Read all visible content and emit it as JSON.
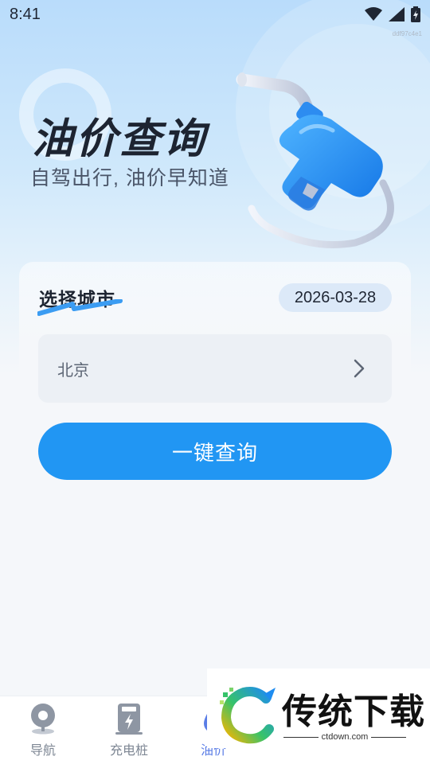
{
  "status_bar": {
    "time": "8:41",
    "tag": "ddf97c4e1",
    "icons": [
      "wifi-icon",
      "signal-icon",
      "battery-icon"
    ]
  },
  "hero": {
    "title": "油价查询",
    "subtitle": "自驾出行, 油价早知道",
    "illustration": "fuel-nozzle-icon"
  },
  "city_section": {
    "title": "选择城市",
    "date": "2026-03-28",
    "selected_city": "北京",
    "chevron_icon": "chevron-right-icon"
  },
  "actions": {
    "query_label": "一键查询"
  },
  "bottom_nav": {
    "items": [
      {
        "label": "导航",
        "icon": "map-pin-icon",
        "active": false
      },
      {
        "label": "充电桩",
        "icon": "charging-pile-icon",
        "active": false
      },
      {
        "label": "油价",
        "icon": "oil-drop-icon",
        "active": true
      }
    ]
  },
  "watermark": {
    "text": "传统下载",
    "domain": "ctdown.com"
  },
  "colors": {
    "accent": "#2196f3",
    "nav_active": "#5a7de6",
    "date_badge_bg": "#dce9f8",
    "title_underline": "#3b9cf2"
  }
}
